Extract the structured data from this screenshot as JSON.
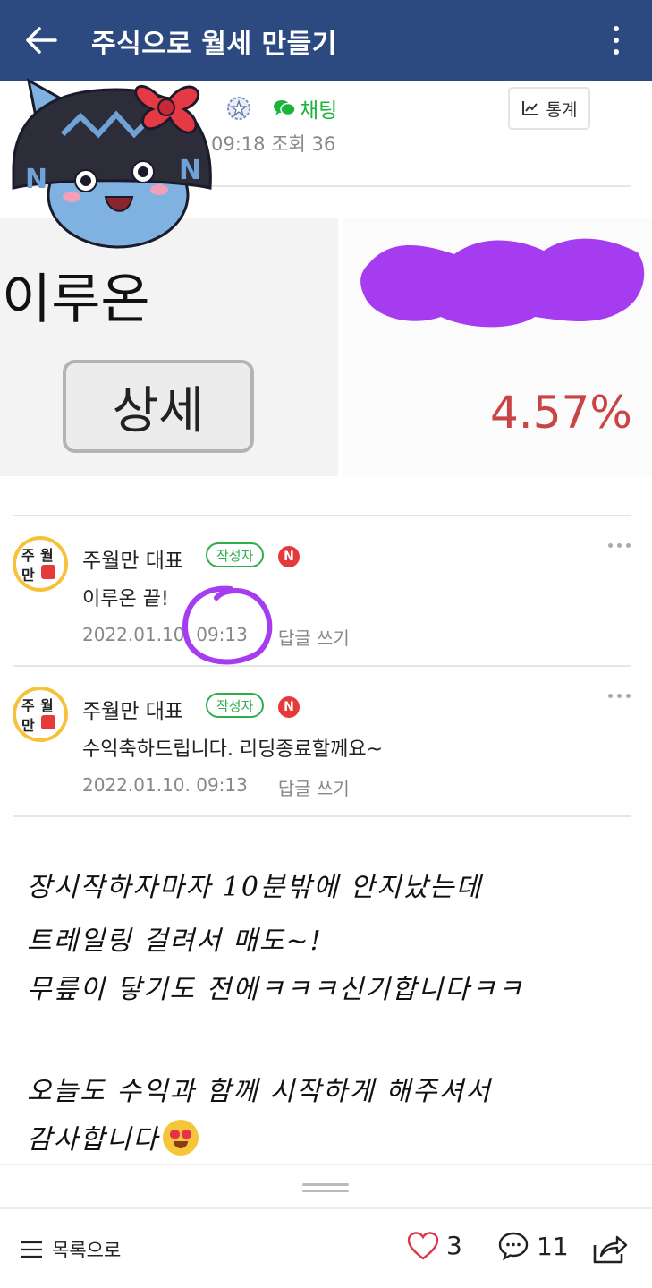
{
  "appbar": {
    "title": "주식으로 월세 만들기"
  },
  "post": {
    "chat_label": "채팅",
    "meta": "09:18  조회 36",
    "stats_label": "통계"
  },
  "embed": {
    "stock_name": "이루온",
    "detail_button": "상세",
    "percent": "4.57%"
  },
  "comments": [
    {
      "author": "주월만 대표",
      "writer_badge": "작성자",
      "new_badge": "N",
      "text": "이루온 끝!",
      "date": "2022.01.10. 09:13",
      "reply": "답글 쓰기"
    },
    {
      "author": "주월만 대표",
      "writer_badge": "작성자",
      "new_badge": "N",
      "text": "수익축하드립니다. 리딩종료할께요~",
      "date": "2022.01.10. 09:13",
      "reply": "답글 쓰기"
    }
  ],
  "body": {
    "lines": [
      "장시작하자마자 10분밖에 안지났는데",
      "트레일링 걸려서 매도~!",
      "무릎이 닿기도 전에ㅋㅋㅋ신기합니다ㅋㅋ",
      "",
      "오늘도 수익과 함께 시작하게 해주셔서",
      "감사합니다"
    ]
  },
  "bottombar": {
    "list_label": "목록으로",
    "like_count": "3",
    "comment_count": "11"
  },
  "colors": {
    "appbar": "#2d4a80",
    "chat_green": "#1bb43a",
    "percent_red": "#c94444",
    "scribble_purple": "#a63cf0"
  }
}
